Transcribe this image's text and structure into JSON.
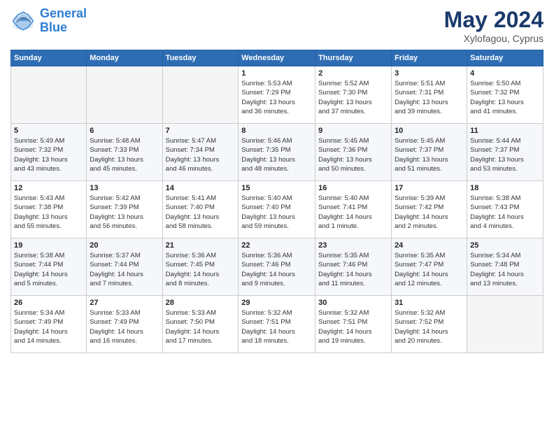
{
  "header": {
    "logo_line1": "General",
    "logo_line2": "Blue",
    "month": "May 2024",
    "location": "Xylofagou, Cyprus"
  },
  "columns": [
    "Sunday",
    "Monday",
    "Tuesday",
    "Wednesday",
    "Thursday",
    "Friday",
    "Saturday"
  ],
  "weeks": [
    [
      {
        "day": "",
        "info": ""
      },
      {
        "day": "",
        "info": ""
      },
      {
        "day": "",
        "info": ""
      },
      {
        "day": "1",
        "info": "Sunrise: 5:53 AM\nSunset: 7:29 PM\nDaylight: 13 hours\nand 36 minutes."
      },
      {
        "day": "2",
        "info": "Sunrise: 5:52 AM\nSunset: 7:30 PM\nDaylight: 13 hours\nand 37 minutes."
      },
      {
        "day": "3",
        "info": "Sunrise: 5:51 AM\nSunset: 7:31 PM\nDaylight: 13 hours\nand 39 minutes."
      },
      {
        "day": "4",
        "info": "Sunrise: 5:50 AM\nSunset: 7:32 PM\nDaylight: 13 hours\nand 41 minutes."
      }
    ],
    [
      {
        "day": "5",
        "info": "Sunrise: 5:49 AM\nSunset: 7:32 PM\nDaylight: 13 hours\nand 43 minutes."
      },
      {
        "day": "6",
        "info": "Sunrise: 5:48 AM\nSunset: 7:33 PM\nDaylight: 13 hours\nand 45 minutes."
      },
      {
        "day": "7",
        "info": "Sunrise: 5:47 AM\nSunset: 7:34 PM\nDaylight: 13 hours\nand 46 minutes."
      },
      {
        "day": "8",
        "info": "Sunrise: 5:46 AM\nSunset: 7:35 PM\nDaylight: 13 hours\nand 48 minutes."
      },
      {
        "day": "9",
        "info": "Sunrise: 5:45 AM\nSunset: 7:36 PM\nDaylight: 13 hours\nand 50 minutes."
      },
      {
        "day": "10",
        "info": "Sunrise: 5:45 AM\nSunset: 7:37 PM\nDaylight: 13 hours\nand 51 minutes."
      },
      {
        "day": "11",
        "info": "Sunrise: 5:44 AM\nSunset: 7:37 PM\nDaylight: 13 hours\nand 53 minutes."
      }
    ],
    [
      {
        "day": "12",
        "info": "Sunrise: 5:43 AM\nSunset: 7:38 PM\nDaylight: 13 hours\nand 55 minutes."
      },
      {
        "day": "13",
        "info": "Sunrise: 5:42 AM\nSunset: 7:39 PM\nDaylight: 13 hours\nand 56 minutes."
      },
      {
        "day": "14",
        "info": "Sunrise: 5:41 AM\nSunset: 7:40 PM\nDaylight: 13 hours\nand 58 minutes."
      },
      {
        "day": "15",
        "info": "Sunrise: 5:40 AM\nSunset: 7:40 PM\nDaylight: 13 hours\nand 59 minutes."
      },
      {
        "day": "16",
        "info": "Sunrise: 5:40 AM\nSunset: 7:41 PM\nDaylight: 14 hours\nand 1 minute."
      },
      {
        "day": "17",
        "info": "Sunrise: 5:39 AM\nSunset: 7:42 PM\nDaylight: 14 hours\nand 2 minutes."
      },
      {
        "day": "18",
        "info": "Sunrise: 5:38 AM\nSunset: 7:43 PM\nDaylight: 14 hours\nand 4 minutes."
      }
    ],
    [
      {
        "day": "19",
        "info": "Sunrise: 5:38 AM\nSunset: 7:44 PM\nDaylight: 14 hours\nand 5 minutes."
      },
      {
        "day": "20",
        "info": "Sunrise: 5:37 AM\nSunset: 7:44 PM\nDaylight: 14 hours\nand 7 minutes."
      },
      {
        "day": "21",
        "info": "Sunrise: 5:36 AM\nSunset: 7:45 PM\nDaylight: 14 hours\nand 8 minutes."
      },
      {
        "day": "22",
        "info": "Sunrise: 5:36 AM\nSunset: 7:46 PM\nDaylight: 14 hours\nand 9 minutes."
      },
      {
        "day": "23",
        "info": "Sunrise: 5:35 AM\nSunset: 7:46 PM\nDaylight: 14 hours\nand 11 minutes."
      },
      {
        "day": "24",
        "info": "Sunrise: 5:35 AM\nSunset: 7:47 PM\nDaylight: 14 hours\nand 12 minutes."
      },
      {
        "day": "25",
        "info": "Sunrise: 5:34 AM\nSunset: 7:48 PM\nDaylight: 14 hours\nand 13 minutes."
      }
    ],
    [
      {
        "day": "26",
        "info": "Sunrise: 5:34 AM\nSunset: 7:49 PM\nDaylight: 14 hours\nand 14 minutes."
      },
      {
        "day": "27",
        "info": "Sunrise: 5:33 AM\nSunset: 7:49 PM\nDaylight: 14 hours\nand 16 minutes."
      },
      {
        "day": "28",
        "info": "Sunrise: 5:33 AM\nSunset: 7:50 PM\nDaylight: 14 hours\nand 17 minutes."
      },
      {
        "day": "29",
        "info": "Sunrise: 5:32 AM\nSunset: 7:51 PM\nDaylight: 14 hours\nand 18 minutes."
      },
      {
        "day": "30",
        "info": "Sunrise: 5:32 AM\nSunset: 7:51 PM\nDaylight: 14 hours\nand 19 minutes."
      },
      {
        "day": "31",
        "info": "Sunrise: 5:32 AM\nSunset: 7:52 PM\nDaylight: 14 hours\nand 20 minutes."
      },
      {
        "day": "",
        "info": ""
      }
    ]
  ]
}
